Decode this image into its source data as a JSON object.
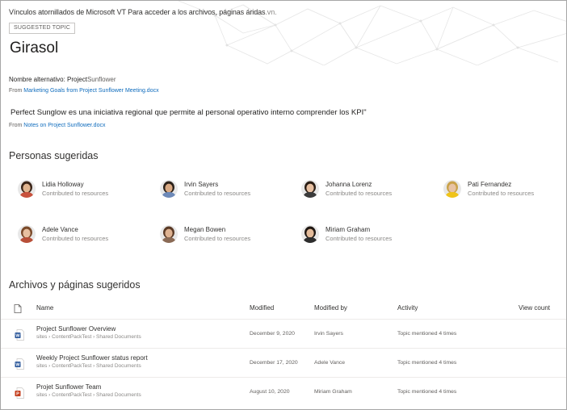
{
  "header": {
    "links_text": "Vínculos atornillados de Microsoft VT Para acceder a los archivos, páginas áridas",
    "links_tail": ".vn.",
    "badge": "SUGGESTED TOPIC",
    "title": "Girasol"
  },
  "alt_name": {
    "label": "Nombre alternativo: Project",
    "value": "Sunflower"
  },
  "source1": {
    "prefix": "From",
    "link": "Marketing Goals from Project Sunflower Meeting.docx"
  },
  "quote": "Perfect Sunglow es una iniciativa regional que permite al personal operativo interno comprender los KPI\"",
  "source2": {
    "prefix": "From",
    "link": "Notes on Project Sunflower.docx"
  },
  "people_section": {
    "heading": "Personas sugeridas",
    "people": [
      {
        "name": "Lidia Holloway",
        "sub": "Contributed to resources",
        "skin": "#e0b48f",
        "hair": "#3a2418",
        "shirt": "#c8523d"
      },
      {
        "name": "Irvin Sayers",
        "sub": "Contributed to resources",
        "skin": "#d9a983",
        "hair": "#2b2119",
        "shirt": "#6d89b8"
      },
      {
        "name": "Johanna Lorenz",
        "sub": "Contributed to resources",
        "skin": "#e6bfa1",
        "hair": "#2a1d14",
        "shirt": "#3b3b3b"
      },
      {
        "name": "Pati Fernandez",
        "sub": "Contributed to resources",
        "skin": "#e8c3a4",
        "hair": "#c9a24a",
        "shirt": "#f0c419"
      },
      {
        "name": "Adele Vance",
        "sub": "Contributed to resources",
        "skin": "#e7c0a0",
        "hair": "#7a4a2a",
        "shirt": "#b84f38"
      },
      {
        "name": "Megan Bowen",
        "sub": "Contributed to resources",
        "skin": "#deb291",
        "hair": "#5a3a26",
        "shirt": "#8a6a55"
      },
      {
        "name": "Miriam Graham",
        "sub": "Contributed to resources",
        "skin": "#e3bb9a",
        "hair": "#1f1712",
        "shirt": "#2d2d2d"
      }
    ]
  },
  "files_section": {
    "heading": "Archivos y páginas sugeridos",
    "columns": {
      "name": "Name",
      "modified": "Modified",
      "modified_by": "Modified by",
      "activity": "Activity",
      "view_count": "View count"
    },
    "rows": [
      {
        "type": "word",
        "letter": "W",
        "color": "#2b579a",
        "name": "Project Sunflower Overview",
        "path": "sites › ContentPackTest › Shared Documents",
        "modified": "December 9, 2020",
        "modified_by": "Irvin Sayers",
        "activity": "Topic mentioned 4 times"
      },
      {
        "type": "word",
        "letter": "W",
        "color": "#2b579a",
        "name": "Weekly Project Sunflower status report",
        "path": "sites › ContentPackTest › Shared Documents",
        "modified": "December 17, 2020",
        "modified_by": "Adele Vance",
        "activity": "Topic mentioned 4 times"
      },
      {
        "type": "powerpoint",
        "letter": "P",
        "color": "#c43e1c",
        "name": "Projet Sunflower Team",
        "path": "sites › ContentPackTest › Shared Documents",
        "modified": "August 10, 2020",
        "modified_by": "Miriam Graham",
        "activity": "Topic mentioned 4 times"
      }
    ]
  }
}
